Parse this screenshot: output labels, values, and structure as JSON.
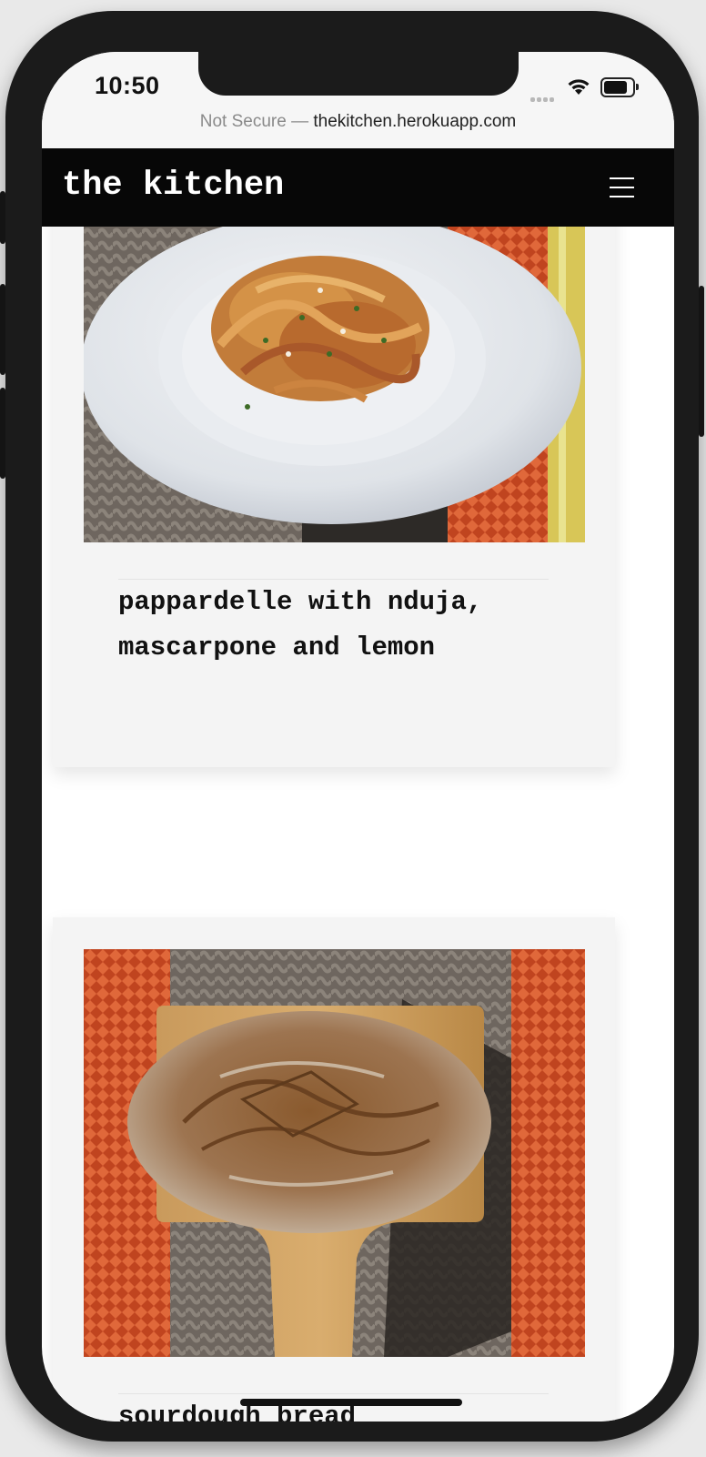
{
  "status_bar": {
    "time": "10:50"
  },
  "url_bar": {
    "security": "Not Secure",
    "separator": "—",
    "host": "thekitchen.herokuapp.com"
  },
  "navbar": {
    "brand": "the kitchen",
    "menu_icon": "hamburger-menu-icon"
  },
  "recipes": [
    {
      "title": "pappardelle with nduja, mascarpone and lemon",
      "image": "pasta-dish-photo"
    },
    {
      "title": "sourdough bread",
      "image": "sourdough-loaf-photo"
    }
  ],
  "colors": {
    "navbar_bg": "#070707",
    "card_bg": "#f4f4f4",
    "text": "#111111"
  }
}
